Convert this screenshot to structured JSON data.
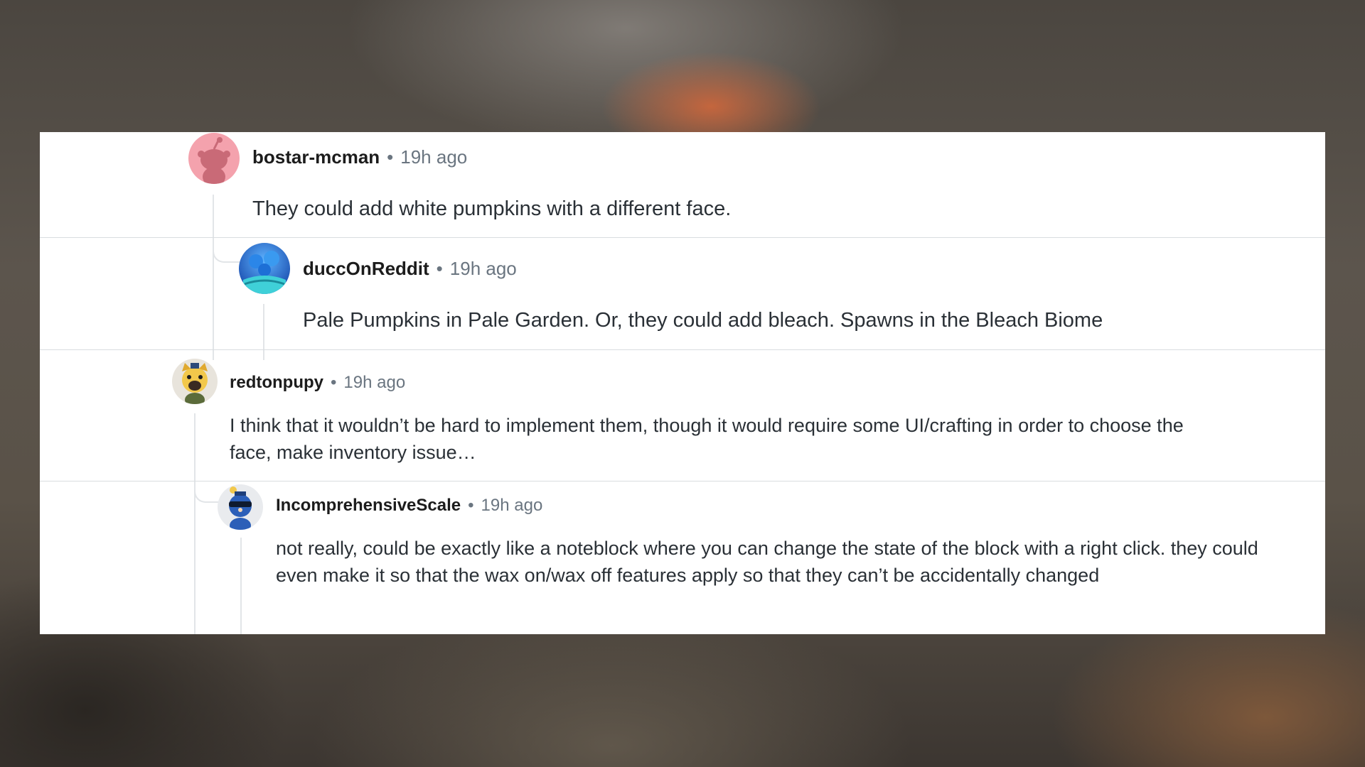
{
  "comments": [
    {
      "username": "bostar-mcman",
      "separator": "•",
      "time": "19h ago",
      "body": "They could add white pumpkins with a different face.",
      "avatar": {
        "icon": "snoo-default-avatar-icon",
        "background": "#f4a2ad",
        "figure": "#c96a77"
      }
    },
    {
      "username": "duccOnReddit",
      "separator": "•",
      "time": "19h ago",
      "body": "Pale Pumpkins in Pale Garden. Or, they could add bleach. Spawns in the Bleach Biome",
      "avatar": {
        "icon": "blue-coral-avatar-icon",
        "background": "#1f6fd1",
        "figure": "#3fd0d8"
      }
    },
    {
      "username": "redtonpupy",
      "separator": "•",
      "time": "19h ago",
      "body": "I think that it wouldn’t be hard to implement them, though it would require some UI/crafting in order to choose the face, make inventory issue…",
      "avatar": {
        "icon": "yellow-dog-avatar-icon",
        "background": "#e8e4dc",
        "figure": "#f2c84b"
      }
    },
    {
      "username": "IncomprehensiveScale",
      "separator": "•",
      "time": "19h ago",
      "body": "not really, could be exactly like a noteblock where you can change the state of the block with a right click. they could even make it so that the wax on/wax off features apply so that they can’t be accidentally changed",
      "avatar": {
        "icon": "blue-ninja-avatar-icon",
        "background": "#e9ebee",
        "figure": "#2c5fb8"
      }
    }
  ],
  "colors": {
    "username": "#1c1c1c",
    "meta": "#6a7580",
    "body": "#2a3036",
    "divider": "#d9dde0",
    "thread_line": "#e2e5e8",
    "panel": "#ffffff"
  }
}
